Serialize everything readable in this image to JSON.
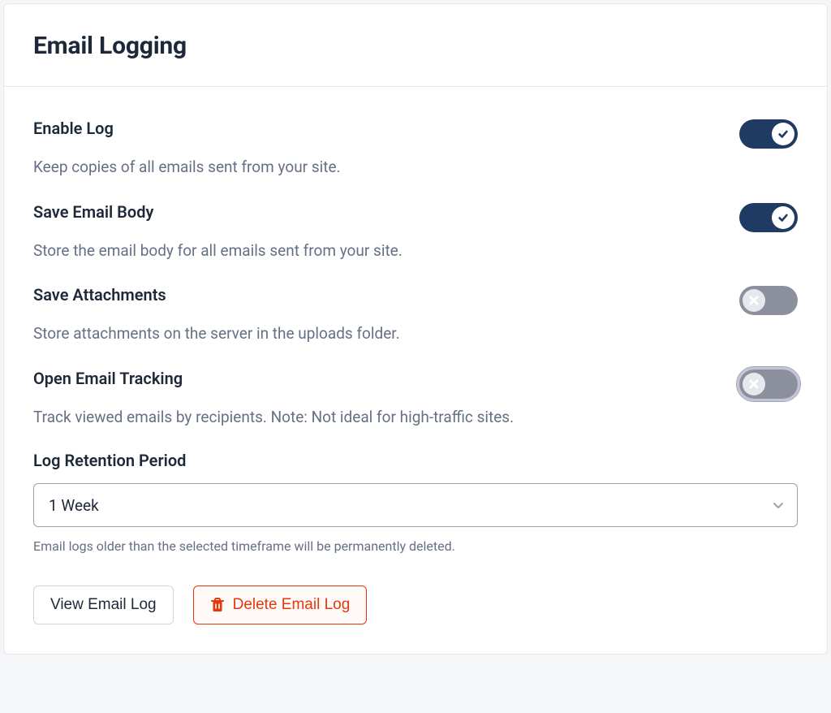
{
  "header": {
    "title": "Email Logging"
  },
  "settings": {
    "enable_log": {
      "label": "Enable Log",
      "description": "Keep copies of all emails sent from your site.",
      "state": "on"
    },
    "save_body": {
      "label": "Save Email Body",
      "description": "Store the email body for all emails sent from your site.",
      "state": "on"
    },
    "save_attachments": {
      "label": "Save Attachments",
      "description": "Store attachments on the server in the uploads folder.",
      "state": "off"
    },
    "open_tracking": {
      "label": "Open Email Tracking",
      "description": "Track viewed emails by recipients. Note: Not ideal for high-traffic sites.",
      "state": "off",
      "focused": true
    }
  },
  "retention": {
    "label": "Log Retention Period",
    "selected": "1 Week",
    "help": "Email logs older than the selected timeframe will be permanently deleted."
  },
  "buttons": {
    "view_label": "View Email Log",
    "delete_label": "Delete Email Log"
  }
}
